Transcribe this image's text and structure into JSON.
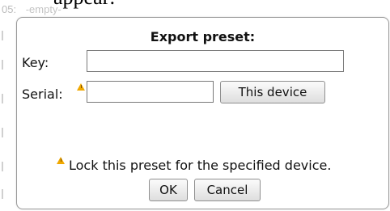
{
  "background": {
    "heading": "appear:",
    "row_label": "05:",
    "row_value": "-empty-"
  },
  "dialog": {
    "title": "Export preset:",
    "key_label": "Key:",
    "key_value": "",
    "serial_label": "Serial:",
    "serial_value": "",
    "this_device_label": "This device",
    "lock_note": "Lock this preset for the specified device.",
    "ok_label": "OK",
    "cancel_label": "Cancel"
  },
  "icons": {
    "warning": "warning-icon"
  },
  "colors": {
    "warning": "#f0a800",
    "border": "#9b9b9b"
  }
}
